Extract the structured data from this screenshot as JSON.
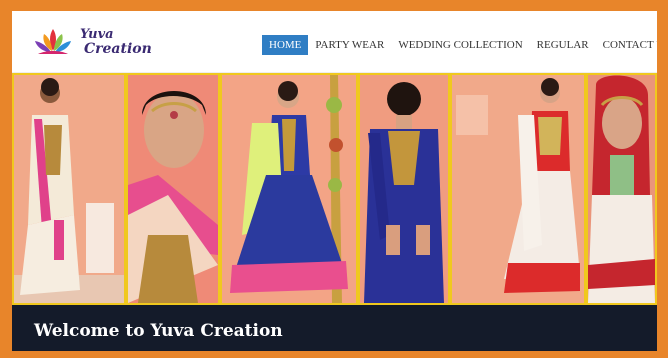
{
  "brand": {
    "line1": "Yuva",
    "line2": "Creation",
    "logo_icon": "lotus-logo-icon"
  },
  "nav": {
    "items": [
      {
        "label": "HOME",
        "active": true
      },
      {
        "label": "PARTY WEAR",
        "active": false
      },
      {
        "label": "WEDDING COLLECTION",
        "active": false
      },
      {
        "label": "REGULAR",
        "active": false
      },
      {
        "label": "CONTACT US",
        "active": false
      }
    ]
  },
  "welcome": {
    "title": "Welcome to Yuva Creation"
  },
  "colors": {
    "frame": "#e8852a",
    "nav_active": "#2f7ec4",
    "panel_border": "#f0c81e",
    "banner_bg": "#141b2a",
    "peach": "#f2a988"
  }
}
